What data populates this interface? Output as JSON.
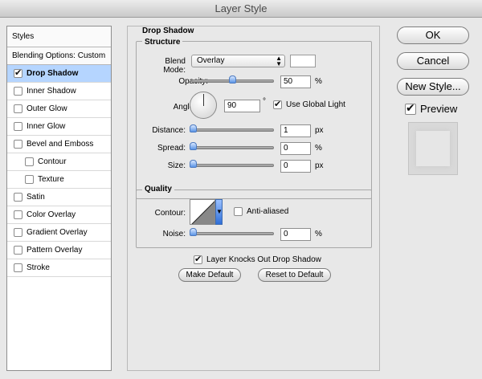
{
  "window": {
    "title": "Layer Style"
  },
  "styles_panel": {
    "header": "Styles",
    "blending_options": "Blending Options: Custom",
    "items": [
      {
        "label": "Drop Shadow",
        "checked": true,
        "selected": true,
        "indent": false
      },
      {
        "label": "Inner Shadow",
        "checked": false,
        "selected": false,
        "indent": false
      },
      {
        "label": "Outer Glow",
        "checked": false,
        "selected": false,
        "indent": false
      },
      {
        "label": "Inner Glow",
        "checked": false,
        "selected": false,
        "indent": false
      },
      {
        "label": "Bevel and Emboss",
        "checked": false,
        "selected": false,
        "indent": false
      },
      {
        "label": "Contour",
        "checked": false,
        "selected": false,
        "indent": true
      },
      {
        "label": "Texture",
        "checked": false,
        "selected": false,
        "indent": true
      },
      {
        "label": "Satin",
        "checked": false,
        "selected": false,
        "indent": false
      },
      {
        "label": "Color Overlay",
        "checked": false,
        "selected": false,
        "indent": false
      },
      {
        "label": "Gradient Overlay",
        "checked": false,
        "selected": false,
        "indent": false
      },
      {
        "label": "Pattern Overlay",
        "checked": false,
        "selected": false,
        "indent": false
      },
      {
        "label": "Stroke",
        "checked": false,
        "selected": false,
        "indent": false
      }
    ]
  },
  "drop_shadow": {
    "title": "Drop Shadow",
    "structure": {
      "title": "Structure",
      "blend_mode_label": "Blend Mode:",
      "blend_mode_value": "Overlay",
      "shadow_color": "#ffffff",
      "opacity_label": "Opacity:",
      "opacity_value": "50",
      "opacity_level": 0.5,
      "percent_unit": "%",
      "angle_label": "Angle:",
      "angle_value": "90",
      "degree_unit": "°",
      "use_global_light_label": "Use Global Light",
      "use_global_light_checked": true,
      "distance_label": "Distance:",
      "distance_value": "1",
      "distance_level": 0.0,
      "px_unit": "px",
      "spread_label": "Spread:",
      "spread_value": "0",
      "spread_level": 0.0,
      "size_label": "Size:",
      "size_value": "0",
      "size_level": 0.0
    },
    "quality": {
      "title": "Quality",
      "contour_label": "Contour:",
      "anti_aliased_label": "Anti-aliased",
      "anti_aliased_checked": false,
      "noise_label": "Noise:",
      "noise_value": "0",
      "noise_level": 0.0
    },
    "knockout_label": "Layer Knocks Out Drop Shadow",
    "knockout_checked": true,
    "make_default_label": "Make Default",
    "reset_default_label": "Reset to Default"
  },
  "actions": {
    "ok_label": "OK",
    "cancel_label": "Cancel",
    "new_style_label": "New Style...",
    "preview_label": "Preview",
    "preview_checked": true
  }
}
